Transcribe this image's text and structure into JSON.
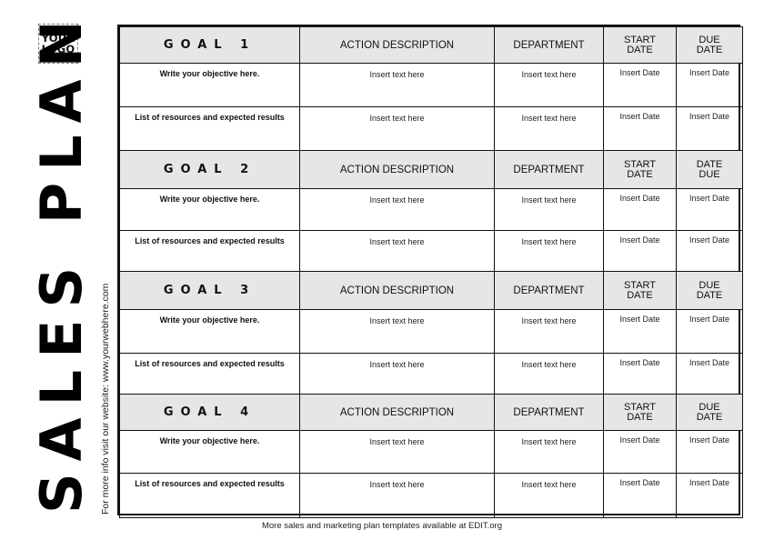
{
  "logo": {
    "line1": "YOUR",
    "line2": "LOGO"
  },
  "title": "SALES PLAN",
  "side_note": "For more info visit our website: www.yourwebhere.com",
  "footer": "More sales and marketing plan templates available at EDIT.org",
  "goals": [
    {
      "header": {
        "goal": "GOAL 1",
        "action": "ACTION  DESCRIPTION",
        "department": "DEPARTMENT",
        "col4_line1": "START",
        "col4_line2": "DATE",
        "col5_line1": "DUE",
        "col5_line2": "DATE"
      },
      "rows": [
        {
          "label": "Write your objective here.",
          "action": "Insert text here",
          "department": "Insert text here",
          "start": "Insert Date",
          "due": "Insert Date"
        },
        {
          "label": "List of resources and expected results",
          "action": "Insert text here",
          "department": "Insert text here",
          "start": "Insert Date",
          "due": "Insert Date"
        }
      ]
    },
    {
      "header": {
        "goal": "GOAL 2",
        "action": "ACTION  DESCRIPTION",
        "department": "DEPARTMENT",
        "col4_line1": "START",
        "col4_line2": "DATE",
        "col5_line1": "DATE",
        "col5_line2": "DUE"
      },
      "rows": [
        {
          "label": "Write your objective here.",
          "action": "Insert text here",
          "department": "Insert text here",
          "start": "Insert Date",
          "due": "Insert Date"
        },
        {
          "label": "List of resources and expected results",
          "action": "Insert text here",
          "department": "Insert text here",
          "start": "Insert Date",
          "due": "Insert Date"
        }
      ]
    },
    {
      "header": {
        "goal": "GOAL 3",
        "action": "ACTION  DESCRIPTION",
        "department": "DEPARTMENT",
        "col4_line1": "START",
        "col4_line2": "DATE",
        "col5_line1": "DUE",
        "col5_line2": "DATE"
      },
      "rows": [
        {
          "label": "Write your objective here.",
          "action": "Insert text here",
          "department": "Insert text here",
          "start": "Insert Date",
          "due": "Insert Date"
        },
        {
          "label": "List of resources and expected results",
          "action": "Insert text here",
          "department": "Insert text here",
          "start": "Insert Date",
          "due": "Insert Date"
        }
      ]
    },
    {
      "header": {
        "goal": "GOAL 4",
        "action": "ACTION  DESCRIPTION",
        "department": "DEPARTMENT",
        "col4_line1": "START",
        "col4_line2": "DATE",
        "col5_line1": "DUE",
        "col5_line2": "DATE"
      },
      "rows": [
        {
          "label": "Write your objective here.",
          "action": "Insert text here",
          "department": "Insert text here",
          "start": "Insert Date",
          "due": "Insert Date"
        },
        {
          "label": "List of resources and expected results",
          "action": "Insert text here",
          "department": "Insert text here",
          "start": "Insert Date",
          "due": "Insert Date"
        }
      ]
    }
  ]
}
